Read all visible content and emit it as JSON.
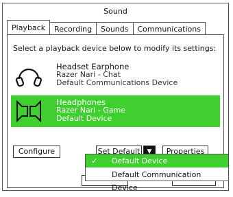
{
  "window": {
    "title": "Sound"
  },
  "tabs": [
    {
      "label": "Playback"
    },
    {
      "label": "Recording"
    },
    {
      "label": "Sounds"
    },
    {
      "label": "Communications"
    }
  ],
  "instruction": "Select a playback device below to modify its settings:",
  "devices": [
    {
      "name": "Headset Earphone",
      "model": "Razer Nari - Chat",
      "status": "Default Communications Device",
      "icon": "headset-icon",
      "selected": false
    },
    {
      "name": "Headphones",
      "model": "Razer Nari - Game",
      "status": "Default Device",
      "icon": "speaker-icon",
      "selected": true
    }
  ],
  "buttons": {
    "configure": "Configure",
    "set_default": "Set Default",
    "properties": "Properties"
  },
  "dropdown": {
    "items": [
      {
        "label": "Default Device",
        "checked": true
      },
      {
        "label": "Default Communication Device",
        "checked": false
      }
    ]
  },
  "colors": {
    "accent": "#3fcf2f"
  }
}
